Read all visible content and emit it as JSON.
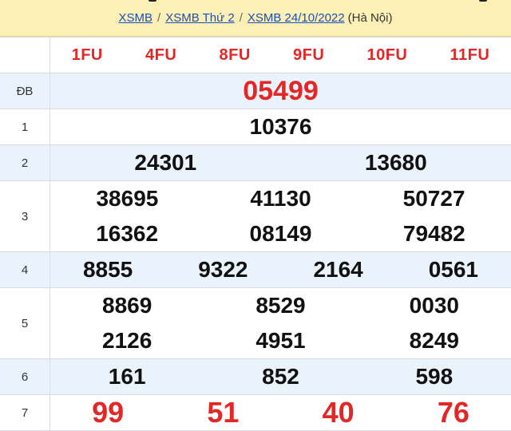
{
  "breadcrumb": {
    "items": [
      "XSMB",
      "Thứ 2",
      "XSMB 24/10/2022"
    ],
    "item2": "XSMB Thứ 2",
    "location": "(Hà Nội)",
    "separator": "/"
  },
  "codes": [
    "1FU",
    "4FU",
    "8FU",
    "9FU",
    "10FU",
    "11FU"
  ],
  "prizes": [
    {
      "label": "ĐB",
      "numbers": [
        "05499"
      ]
    },
    {
      "label": "1",
      "numbers": [
        "10376"
      ]
    },
    {
      "label": "2",
      "numbers": [
        "24301",
        "13680"
      ]
    },
    {
      "label": "3",
      "numbers": [
        "38695",
        "41130",
        "50727",
        "16362",
        "08149",
        "79482"
      ]
    },
    {
      "label": "4",
      "numbers": [
        "8855",
        "9322",
        "2164",
        "0561"
      ]
    },
    {
      "label": "5",
      "numbers": [
        "8869",
        "8529",
        "0030",
        "2126",
        "4951",
        "8249"
      ]
    },
    {
      "label": "6",
      "numbers": [
        "161",
        "852",
        "598"
      ]
    },
    {
      "label": "7",
      "numbers": [
        "99",
        "51",
        "40",
        "76"
      ]
    }
  ],
  "colors": {
    "header_bg": "#fdf0b6",
    "alt_row_bg": "#eaf2fb",
    "accent_red": "#e32626",
    "link_blue": "#1a4fb5"
  }
}
